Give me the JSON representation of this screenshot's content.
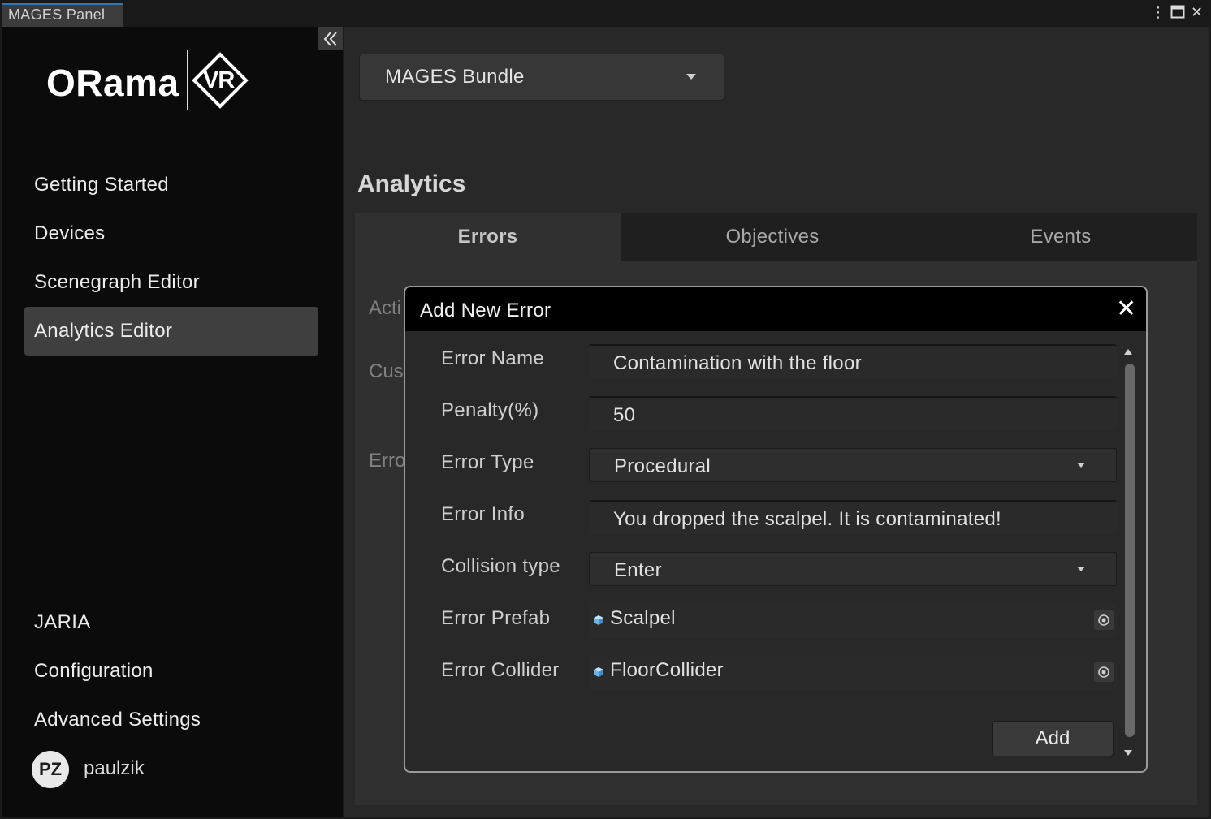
{
  "window": {
    "title": "MAGES Panel",
    "controls": {
      "menu_icon": "kebab-menu-icon",
      "maximize_icon": "maximize-icon",
      "close_icon": "close-icon"
    }
  },
  "sidebar": {
    "logo_text": "ORama",
    "logo_mark": "VR",
    "collapse_icon": "double-chevron-left-icon",
    "nav_items": [
      {
        "label": "Getting Started"
      },
      {
        "label": "Devices"
      },
      {
        "label": "Scenegraph Editor"
      },
      {
        "label": "Analytics Editor",
        "active": true
      }
    ],
    "bottom_items": [
      {
        "label": "JARIA"
      },
      {
        "label": "Configuration"
      },
      {
        "label": "Advanced Settings"
      }
    ],
    "user": {
      "initials": "PZ",
      "name": "paulzik"
    }
  },
  "main": {
    "bundle_dropdown": {
      "selected": "MAGES Bundle"
    },
    "section_title": "Analytics",
    "tabs": [
      {
        "label": "Errors",
        "active": true
      },
      {
        "label": "Objectives"
      },
      {
        "label": "Events"
      }
    ],
    "background_labels": [
      "Acti",
      "Cus",
      "Erro"
    ]
  },
  "modal": {
    "title": "Add New Error",
    "fields": {
      "error_name": {
        "label": "Error Name",
        "value": "Contamination with the floor"
      },
      "penalty": {
        "label": "Penalty(%)",
        "value": "50"
      },
      "error_type": {
        "label": "Error Type",
        "value": "Procedural"
      },
      "error_info": {
        "label": "Error Info",
        "value": "You dropped the scalpel. It is contaminated!"
      },
      "collision_type": {
        "label": "Collision type",
        "value": "Enter"
      },
      "error_prefab": {
        "label": "Error Prefab",
        "value": "Scalpel"
      },
      "error_collider": {
        "label": "Error Collider",
        "value": "FloorCollider"
      }
    },
    "add_button": "Add"
  },
  "colors": {
    "accent": "#2f76b5",
    "sidebar_bg": "#0b0b0b",
    "content_bg": "#282828",
    "modal_header_bg": "#000000",
    "prefab_cube": "#6ab4e8"
  }
}
